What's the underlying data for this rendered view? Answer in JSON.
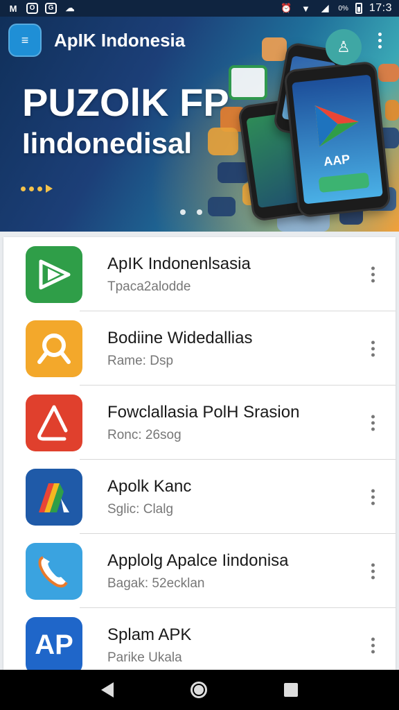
{
  "status_bar": {
    "left_icons": [
      "gmail-icon",
      "camera-icon",
      "message-icon",
      "cloud-icon"
    ],
    "battery": "0%",
    "time": "17:3"
  },
  "app_bar": {
    "title": "ApIK Indonesia"
  },
  "hero": {
    "headline": "PUZOlK FP",
    "subline": "Iindonedisal",
    "phone_label": "AAP",
    "brand_colors": {
      "dark_blue": "#10305a",
      "teal": "#3aa7b5",
      "orange": "#f2a23a"
    }
  },
  "apps": [
    {
      "title": "ApIK Indonenlsasia",
      "subtitle": "Tpaca2alodde",
      "icon": "green-play-icon",
      "color": "#2f9e48"
    },
    {
      "title": "Bodiine Widedallias",
      "subtitle": "Rame: Dsp",
      "icon": "search-icon",
      "color": "#f3a82b"
    },
    {
      "title": "Fowclallasia PolH Srasion",
      "subtitle": "Ronc: 26sog",
      "icon": "triangle-icon",
      "color": "#e0402d"
    },
    {
      "title": "Apolk Kanc",
      "subtitle": "Sglic: Clalg",
      "icon": "colorful-a-icon",
      "color": "#1f5aa8"
    },
    {
      "title": "Applolg Apalce Iindonisa",
      "subtitle": "Bagak: 52ecklan",
      "icon": "phone-call-icon",
      "color": "#3aa3e0"
    },
    {
      "title": "Splam APK",
      "subtitle": "Parike Ukala",
      "icon": "ap-logo-icon",
      "color": "#1f66c9",
      "icon_text": "AP"
    }
  ]
}
